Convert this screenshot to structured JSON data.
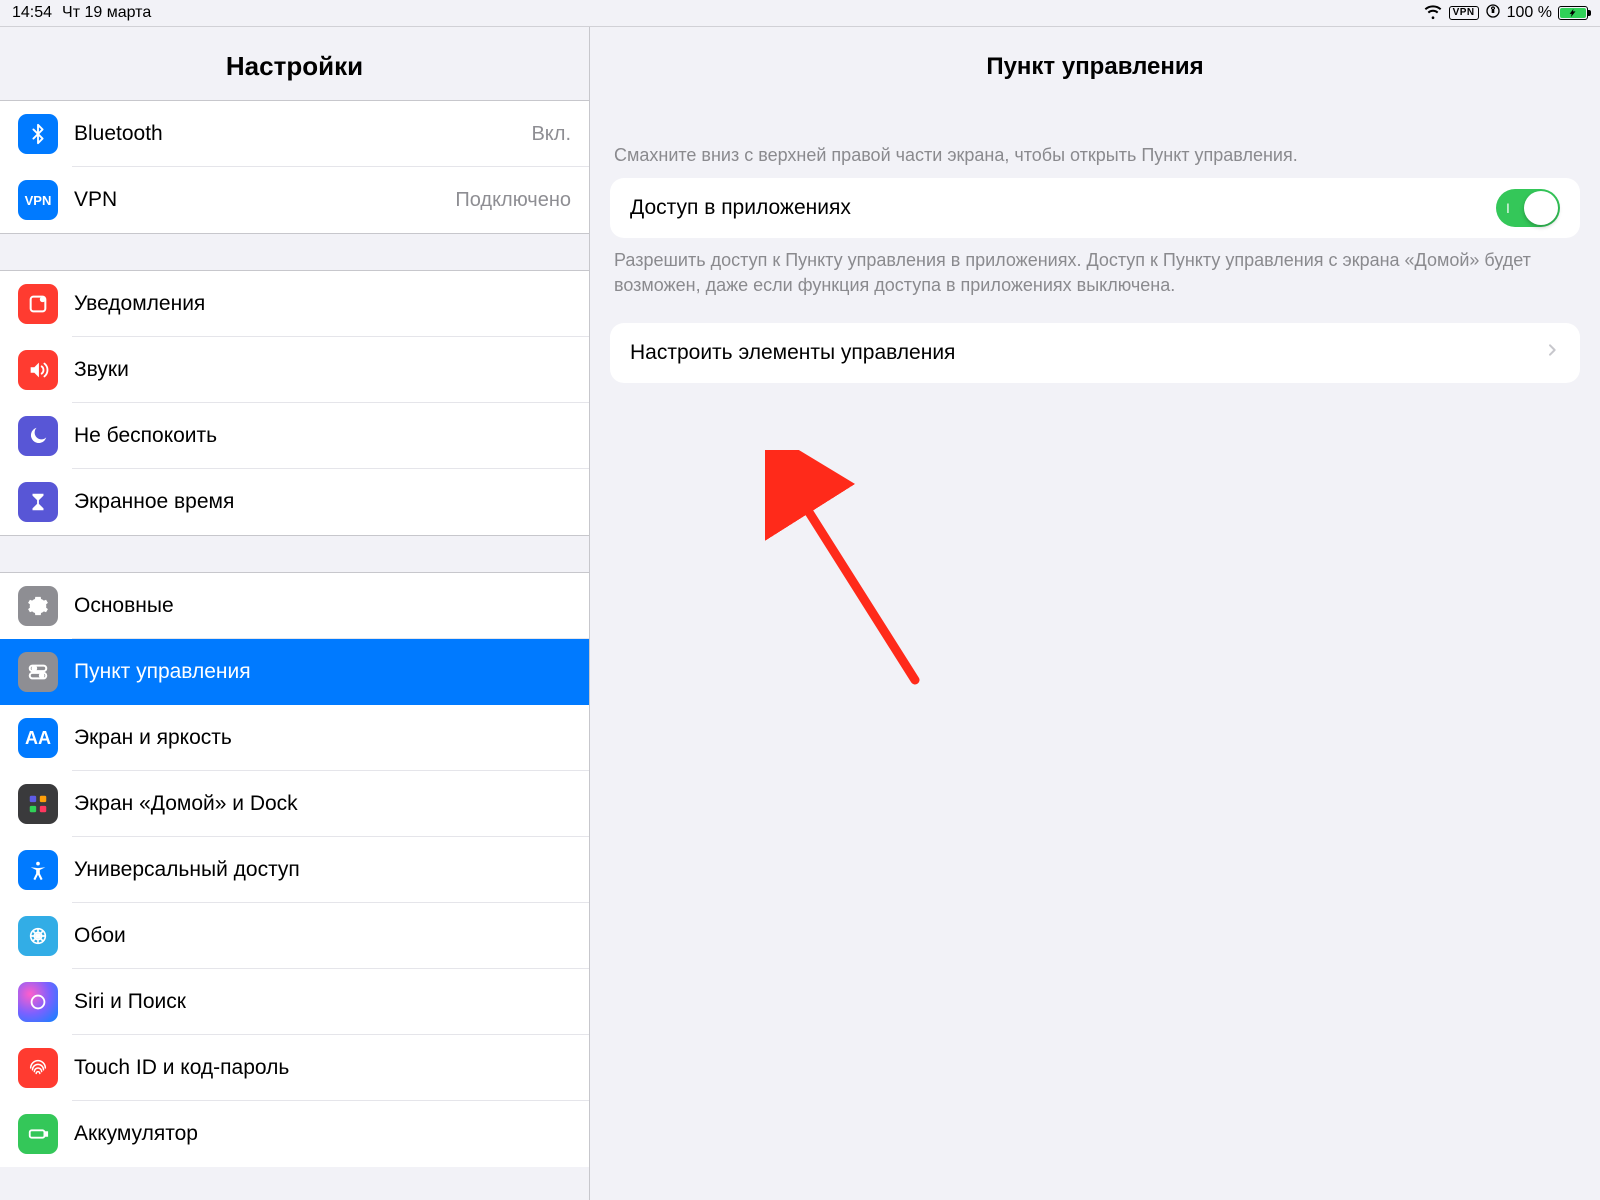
{
  "status": {
    "time": "14:54",
    "date": "Чт 19 марта",
    "vpn": "VPN",
    "battery": "100 %"
  },
  "sidebar": {
    "title": "Настройки",
    "groups": [
      [
        {
          "label": "Bluetooth",
          "status": "Вкл.",
          "icon": "bluetooth",
          "bg": "bg-blue"
        },
        {
          "label": "VPN",
          "status": "Подключено",
          "icon": "vpn",
          "bg": "bg-blue"
        }
      ],
      [
        {
          "label": "Уведомления",
          "icon": "notify",
          "bg": "bg-red"
        },
        {
          "label": "Звуки",
          "icon": "sound",
          "bg": "bg-red"
        },
        {
          "label": "Не беспокоить",
          "icon": "moon",
          "bg": "bg-purple"
        },
        {
          "label": "Экранное время",
          "icon": "hourglass",
          "bg": "bg-purple"
        }
      ],
      [
        {
          "label": "Основные",
          "icon": "gear",
          "bg": "bg-gray"
        },
        {
          "label": "Пункт управления",
          "icon": "cc",
          "bg": "bg-gray",
          "selected": true
        },
        {
          "label": "Экран и яркость",
          "icon": "aa",
          "bg": "bg-blue"
        },
        {
          "label": "Экран «Домой» и Dock",
          "icon": "dock",
          "bg": "bg-dock"
        },
        {
          "label": "Универсальный доступ",
          "icon": "acc",
          "bg": "bg-blue"
        },
        {
          "label": "Обои",
          "icon": "wall",
          "bg": "bg-cyan"
        },
        {
          "label": "Siri и Поиск",
          "icon": "siri",
          "bg": "bg-grad"
        },
        {
          "label": "Touch ID и код-пароль",
          "icon": "touch",
          "bg": "bg-red"
        },
        {
          "label": "Аккумулятор",
          "icon": "batt",
          "bg": "bg-green"
        }
      ]
    ]
  },
  "detail": {
    "title": "Пункт управления",
    "hint_top": "Смахните вниз с верхней правой части экрана, чтобы открыть Пункт управления.",
    "toggle": {
      "label": "Доступ в приложениях",
      "on": true
    },
    "hint_below": "Разрешить доступ к Пункту управления в приложениях. Доступ к Пункту управления с экрана «Домой» будет возможен, даже если функция доступа в приложениях выключена.",
    "action": {
      "label": "Настроить элементы управления"
    }
  }
}
